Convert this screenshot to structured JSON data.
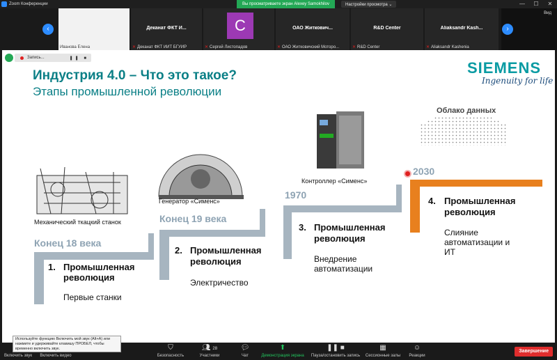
{
  "window": {
    "title": "Zoom Конференции",
    "sharing_banner": "Вы просматриваете экран Alexey Samokhilov",
    "view_options": "Настройки просмотра ⌄",
    "win_controls": [
      "—",
      "☐",
      "✕"
    ]
  },
  "thumbnails": {
    "view_label": "Вид",
    "prev_icon": "‹",
    "next_icon": "›",
    "tiles": [
      {
        "name": "",
        "footer": "Иванова Елена"
      },
      {
        "name": "Деканат ФКТ И...",
        "footer": "Деканат ФКТ ИИТ БГУИР"
      },
      {
        "name": "",
        "footer": "Сергей Листопадов",
        "avatar_letter": "С"
      },
      {
        "name": "ОАО Житкович...",
        "footer": "ОАО Житковичский Моторо..."
      },
      {
        "name": "R&D Center",
        "footer": "R&D Center"
      },
      {
        "name": "Aliaksandr Kash...",
        "footer": "Aliaksandr Kashenia"
      }
    ]
  },
  "recording": {
    "label": "Запись...",
    "controls": "❚❚ ■"
  },
  "slide": {
    "title": "Индустрия 4.0 – Что это такое?",
    "subtitle": "Этапы промышленной революции",
    "brand": "SIEMENS",
    "tagline": "Ingenuity for life",
    "captions": {
      "loom": "Механический ткацкий станок",
      "generator": "Генератор «Сименс»",
      "controller": "Контроллер «Сименс»",
      "cloud": "Облако данных"
    },
    "stages": [
      {
        "era": "Конец 18 века",
        "num": "1.",
        "title_1": "Промышленная",
        "title_2": "революция",
        "desc_1": "Первые станки",
        "desc_2": ""
      },
      {
        "era": "Конец 19 века",
        "num": "2.",
        "title_1": "Промышленная",
        "title_2": "революция",
        "desc_1": "Электричество",
        "desc_2": ""
      },
      {
        "era": "1970",
        "num": "3.",
        "title_1": "Промышленная",
        "title_2": "революция",
        "desc_1": "Внедрение",
        "desc_2": "автоматизации"
      },
      {
        "era": "2030",
        "num": "4.",
        "title_1": "Промышленная",
        "title_2": "революция",
        "desc_1": "Слияние",
        "desc_2": "автоматизации и",
        "desc_3": "ИТ"
      }
    ],
    "colors": {
      "accent": "#0a7f86",
      "step_grey": "#a7b5c0",
      "step_orange": "#e8801e"
    }
  },
  "toolbar": {
    "items": [
      {
        "label": "Включить звук",
        "icon": "mic-muted-icon"
      },
      {
        "label": "Включить видео",
        "icon": "video-off-icon"
      },
      {
        "label": "Безопасность",
        "icon": "shield-icon"
      },
      {
        "label": "Участники",
        "icon": "participants-icon",
        "count": "28"
      },
      {
        "label": "Чат",
        "icon": "chat-icon"
      },
      {
        "label": "Демонстрация экрана",
        "icon": "share-screen-icon"
      },
      {
        "label": "Пауза/остановить запись",
        "icon": "pause-record-icon"
      },
      {
        "label": "Сессионные залы",
        "icon": "breakout-rooms-icon"
      },
      {
        "label": "Реакции",
        "icon": "reactions-icon"
      }
    ],
    "end_label": "Завершение",
    "tooltip": "Используйте функцию Включить мой звук (Alt+A) или нажмите и удерживайте клавишу ПРОБЕЛ, чтобы временно включить звук."
  }
}
